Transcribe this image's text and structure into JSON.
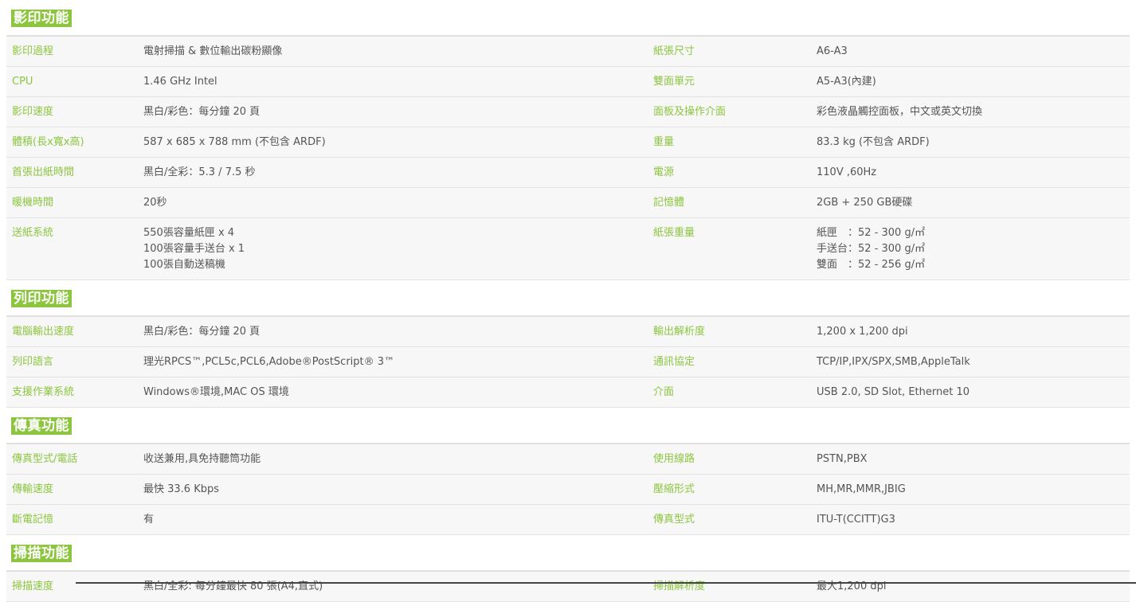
{
  "sections": [
    {
      "title": "影印功能",
      "rows": [
        {
          "l1": "影印過程",
          "v1": [
            "電射掃描 & 數位輸出碳粉顯像"
          ],
          "l2": "紙張尺寸",
          "v2": [
            "A6-A3"
          ]
        },
        {
          "l1": "CPU",
          "v1": [
            "1.46 GHz Intel"
          ],
          "l2": "雙面單元",
          "v2": [
            "A5-A3(內建)"
          ]
        },
        {
          "l1": "影印速度",
          "v1": [
            "黑白/彩色：每分鐘 20 頁"
          ],
          "l2": "面板及操作介面",
          "v2": [
            "彩色液晶觸控面板，中文或英文切換"
          ]
        },
        {
          "l1": "體積(長x寬x高)",
          "v1": [
            "587 x 685 x 788 mm (不包含 ARDF)"
          ],
          "l2": "重量",
          "v2": [
            "83.3 kg (不包含 ARDF)"
          ]
        },
        {
          "l1": "首張出紙時間",
          "v1": [
            "黑白/全彩：5.3 / 7.5 秒"
          ],
          "l2": "電源",
          "v2": [
            "110V ,60Hz"
          ]
        },
        {
          "l1": "暖機時間",
          "v1": [
            "20秒"
          ],
          "l2": "記憶體",
          "v2": [
            "2GB + 250 GB硬碟"
          ]
        },
        {
          "l1": "送紙系統",
          "v1": [
            "550張容量紙匣 x 4",
            "100張容量手送台 x 1",
            "100張自動送稿機"
          ],
          "l2": "紙張重量",
          "v2": [
            "紙匣　：52 - 300 g/㎡",
            "手送台：52 - 300 g/㎡",
            "雙面　：52 - 256 g/㎡"
          ]
        }
      ]
    },
    {
      "title": "列印功能",
      "rows": [
        {
          "l1": "電腦輸出速度",
          "v1": [
            "黑白/彩色：每分鐘 20 頁"
          ],
          "l2": "輸出解析度",
          "v2": [
            "1,200 x 1,200 dpi"
          ]
        },
        {
          "l1": "列印語言",
          "v1": [
            "理光RPCS™,PCL5c,PCL6,Adobe®PostScript® 3™"
          ],
          "l2": "通訊協定",
          "v2": [
            "TCP/IP,IPX/SPX,SMB,AppleTalk"
          ]
        },
        {
          "l1": "支援作業系統",
          "v1": [
            "Windows®環境,MAC OS 環境"
          ],
          "l2": "介面",
          "v2": [
            "USB 2.0, SD Slot, Ethernet 10"
          ]
        }
      ]
    },
    {
      "title": "傳真功能",
      "rows": [
        {
          "l1": "傳真型式/電話",
          "v1": [
            "收送兼用,具免持聽筒功能"
          ],
          "l2": "使用線路",
          "v2": [
            "PSTN,PBX"
          ]
        },
        {
          "l1": "傳輸速度",
          "v1": [
            "最快 33.6 Kbps"
          ],
          "l2": "壓縮形式",
          "v2": [
            "MH,MR,MMR,JBIG"
          ]
        },
        {
          "l1": "斷電記憶",
          "v1": [
            "有"
          ],
          "l2": "傳真型式",
          "v2": [
            "ITU-T(CCITT)G3"
          ]
        }
      ]
    },
    {
      "title": "掃描功能",
      "rows": [
        {
          "l1": "掃描速度",
          "v1": [
            "黑白/全彩: 每分鐘最快 80 張(A4,直式)"
          ],
          "l2": "掃描解析度",
          "v2": [
            "最大1,200 dpi"
          ]
        }
      ]
    }
  ],
  "colors": {
    "accent": "#8cc63f",
    "row_bg": "#f7f7f7",
    "text": "#555555"
  }
}
